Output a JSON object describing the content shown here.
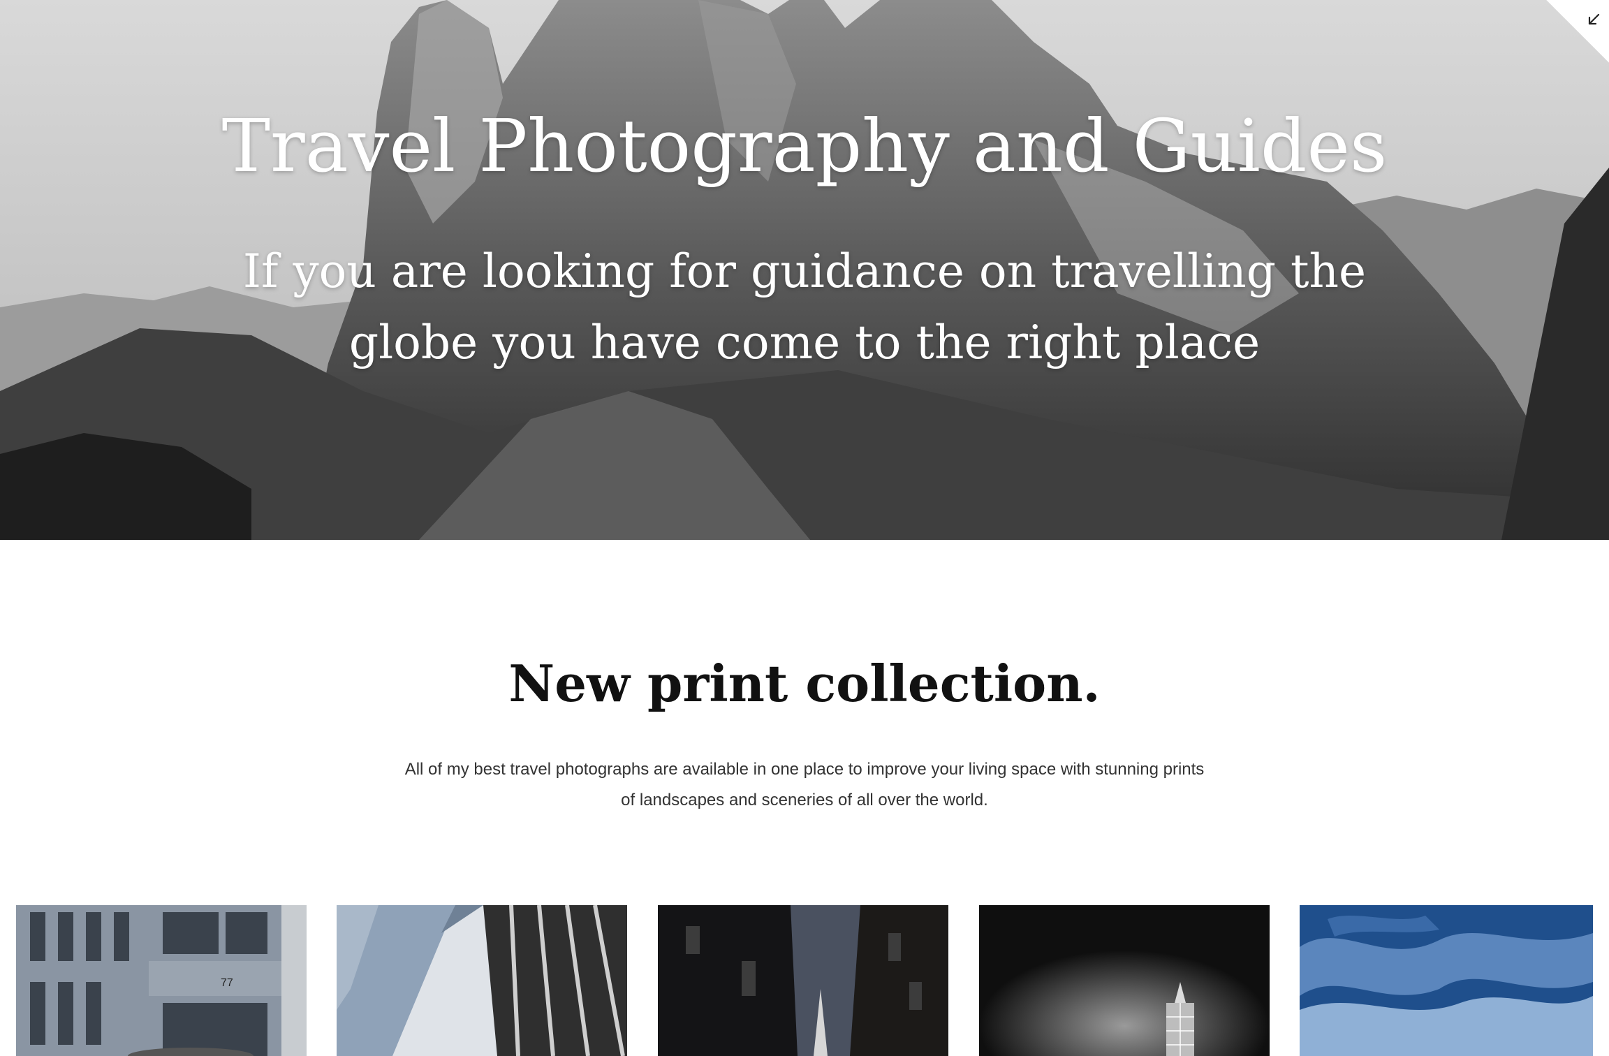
{
  "hero": {
    "title": "Travel Photography and Guides",
    "subtitle": "If you are looking for guidance on travelling the globe you have come to the right place",
    "image": "black-and-white-mountain-peaks",
    "corner_icon": "arrow-down-left-icon"
  },
  "collection": {
    "title": "New print collection.",
    "description": "All of my best travel photographs are available in one place to improve your living space with stunning prints of landscapes and sceneries of all over the world."
  },
  "prints": [
    {
      "image": "building-facade-77",
      "label": "77"
    },
    {
      "image": "glass-skyscrapers-looking-up"
    },
    {
      "image": "dark-alley-with-shard-tower"
    },
    {
      "image": "illuminated-tower-at-night"
    },
    {
      "image": "blue-cloudy-sky"
    }
  ],
  "colors": {
    "background": "#ffffff",
    "text": "#111111",
    "hero_text": "#ffffff",
    "sky_blue": "#1f4f8c"
  }
}
